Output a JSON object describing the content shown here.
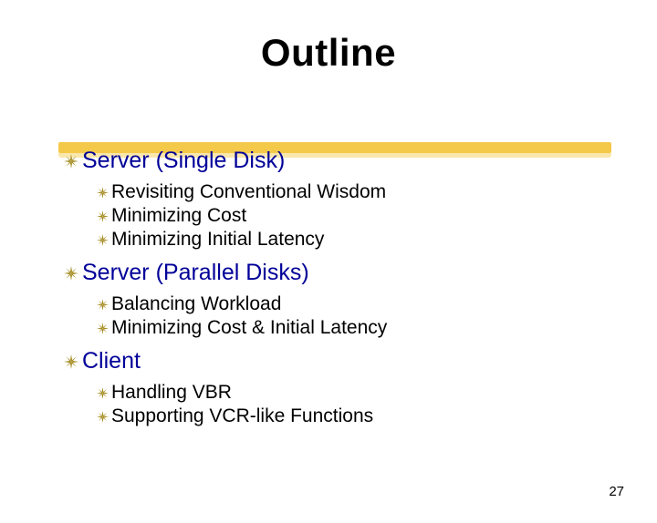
{
  "title": "Outline",
  "sections": [
    {
      "header": "Server (Single Disk)",
      "items": [
        "Revisiting Conventional Wisdom",
        "Minimizing Cost",
        "Minimizing Initial Latency"
      ]
    },
    {
      "header": "Server (Parallel Disks)",
      "items": [
        "Balancing Workload",
        "Minimizing Cost & Initial Latency"
      ]
    },
    {
      "header": "Client",
      "items": [
        "Handling VBR",
        "Supporting VCR-like Functions"
      ]
    }
  ],
  "page_number": "27",
  "colors": {
    "heading": "#000099",
    "underline": "#f4c94a",
    "bullet": "#a58c20"
  }
}
